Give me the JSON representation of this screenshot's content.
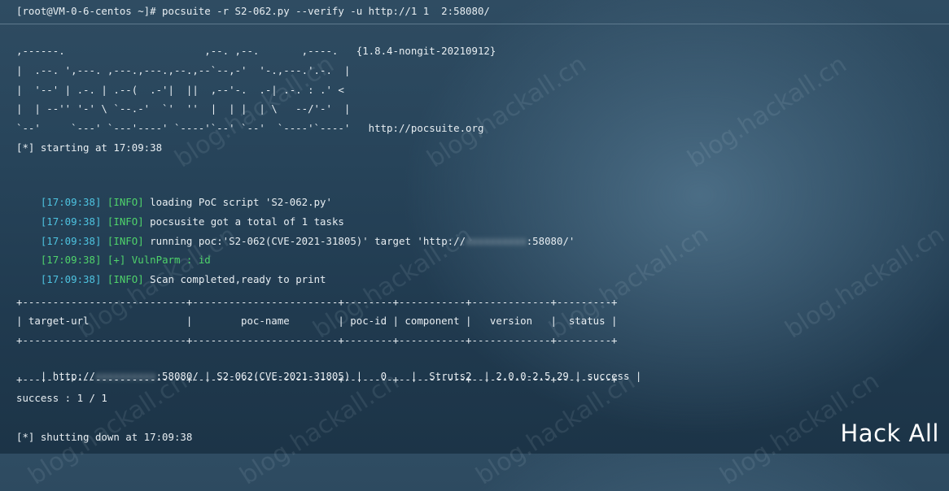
{
  "terminal": {
    "command": "[root@VM-0-6-centos ~]# pocsuite -r S2-062.py --verify -u http://1 1  2:58080/",
    "banner": [
      ",------.                       ,--. ,--.       ,----.   {1.8.4-nongit-20210912}",
      "|  .--. ',---. ,---.,---.,--.,--`--,-'  '-.,---.'.-.  |",
      "|  '--' | .-. | .--(  .-'|  ||  ,--'-.  .-| .-. : .' <",
      "|  | --'' '-' \\ `--.-'  `'  ''  |  | |  | \\   --/'-'  |",
      "`--'     `---' `---'----' `----'`--' `--'  `----'`----'   http://pocsuite.org"
    ],
    "starting": "[*] starting at 17:09:38",
    "logs": [
      {
        "ts": "[17:09:38]",
        "level": "[INFO]",
        "msg": "loading PoC script 'S2-062.py'"
      },
      {
        "ts": "[17:09:38]",
        "level": "[INFO]",
        "msg": "pocsusite got a total of 1 tasks"
      },
      {
        "ts": "[17:09:38]",
        "level": "[INFO]",
        "msg_pre": "running poc:'S2-062(CVE-2021-31805)' target 'http://",
        "msg_post": ":58080/'"
      },
      {
        "ts": "[17:09:38]",
        "level": "[+]",
        "msg": "VulnParm : id"
      },
      {
        "ts": "[17:09:38]",
        "level": "[INFO]",
        "msg": "Scan completed,ready to print"
      }
    ],
    "table": {
      "border": "+---------------------------+------------------------+--------+-----------+-------------+---------+",
      "header": "| target-url                |        poc-name        | poc-id | component |   version   |  status |",
      "row_pre": "| http://",
      "row_post": ":58080/ | S2-062(CVE-2021-31805) |   0    |  Struts2  | 2.0.0-2.5.29 | success |"
    },
    "result": "success : 1 / 1",
    "shutdown": "[*] shutting down at 17:09:38"
  },
  "watermark": "blog.hackall.cn",
  "brand": "Hack All"
}
